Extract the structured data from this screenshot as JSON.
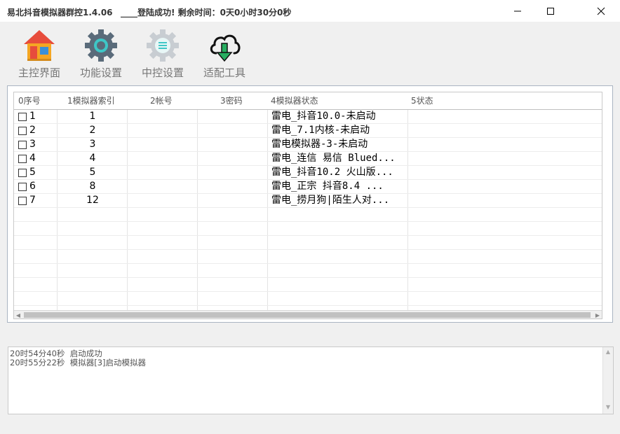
{
  "window": {
    "title": "易北抖音模拟器群控1.4.06",
    "status": "____登陆成功! 剩余时间：0天0小时30分0秒"
  },
  "toolbar": {
    "buttons": [
      {
        "label": "主控界面",
        "icon": "house-icon"
      },
      {
        "label": "功能设置",
        "icon": "gear-icon"
      },
      {
        "label": "中控设置",
        "icon": "settings-gear-icon"
      },
      {
        "label": "适配工具",
        "icon": "cloud-download-icon"
      }
    ]
  },
  "table": {
    "columns": [
      "0序号",
      "1模拟器索引",
      "2帐号",
      "3密码",
      "4模拟器状态",
      "5状态"
    ],
    "rows": [
      {
        "seq": "1",
        "index": "1",
        "account": "",
        "password": "",
        "emulator_status": "雷电_抖音10.0-未启动",
        "status": ""
      },
      {
        "seq": "2",
        "index": "2",
        "account": "",
        "password": "",
        "emulator_status": "雷电_7.1内核-未启动",
        "status": ""
      },
      {
        "seq": "3",
        "index": "3",
        "account": "",
        "password": "",
        "emulator_status": "雷电模拟器-3-未启动",
        "status": ""
      },
      {
        "seq": "4",
        "index": "4",
        "account": "",
        "password": "",
        "emulator_status": "雷电_连信 易信 Blued...",
        "status": ""
      },
      {
        "seq": "5",
        "index": "5",
        "account": "",
        "password": "",
        "emulator_status": "雷电_抖音10.2 火山版...",
        "status": ""
      },
      {
        "seq": "6",
        "index": "8",
        "account": "",
        "password": "",
        "emulator_status": "雷电_正宗  抖音8.4 ...",
        "status": ""
      },
      {
        "seq": "7",
        "index": "12",
        "account": "",
        "password": "",
        "emulator_status": "雷电_捞月狗|陌生人对...",
        "status": ""
      }
    ]
  },
  "log": {
    "lines": [
      "20时54分40秒  启动成功",
      "20时55分22秒  模拟器[3]启动模拟器"
    ]
  },
  "colors": {
    "house_roof": "#e74c3c",
    "house_wall": "#f5a623",
    "house_window": "#3a8fd9",
    "gear": "#5a6b7a",
    "gear_center": "#3ec7c7",
    "download_arrow": "#27ae60"
  }
}
